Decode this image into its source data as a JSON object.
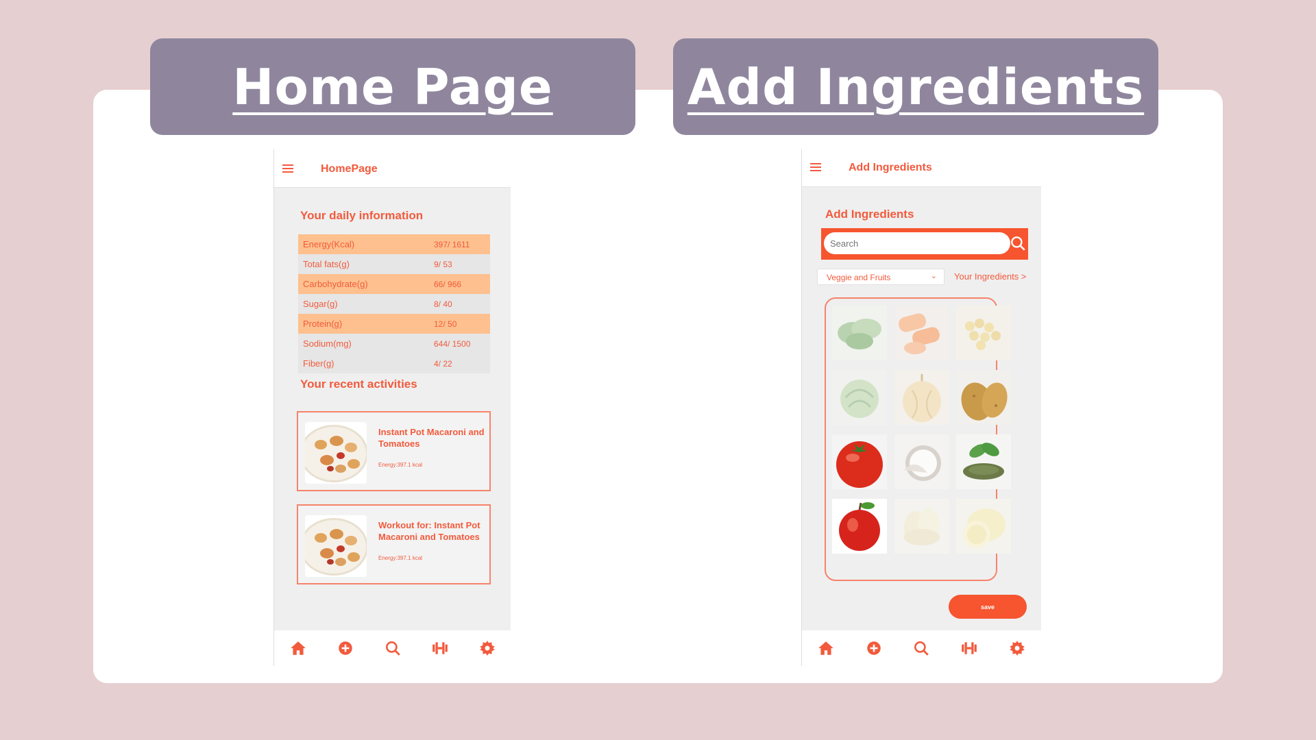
{
  "banners": {
    "home": "Home Page",
    "add": "Add Ingredients"
  },
  "home": {
    "appbar_title": "HomePage",
    "daily_title": "Your daily information",
    "nutrients": [
      {
        "name": "Energy(Kcal)",
        "value": "397/ 1611"
      },
      {
        "name": "Total fats(g)",
        "value": "9/ 53"
      },
      {
        "name": "Carbohydrate(g)",
        "value": "66/ 966"
      },
      {
        "name": "Sugar(g)",
        "value": "8/ 40"
      },
      {
        "name": "Protein(g)",
        "value": "12/ 50"
      },
      {
        "name": "Sodium(mg)",
        "value": "644/ 1500"
      },
      {
        "name": "Fiber(g)",
        "value": "4/ 22"
      }
    ],
    "recent_title": "Your recent activities",
    "activities": [
      {
        "title": "Instant Pot Macaroni and Tomatoes",
        "energy": "Energy:397.1 kcal"
      },
      {
        "title": "Workout for: Instant Pot Macaroni and Tomatoes",
        "energy": "Energy:397.1 kcal"
      }
    ]
  },
  "add": {
    "appbar_title": "Add Ingredients",
    "page_title": "Add Ingredients",
    "search_placeholder": "Search",
    "category": "Veggie and Fruits",
    "your_ingredients": "Your Ingredients >",
    "ingredients": [
      "spinach",
      "carrot",
      "chickpeas",
      "cabbage",
      "onion",
      "potato",
      "tomato",
      "coconut",
      "herbs",
      "apple",
      "garlic",
      "lemon"
    ],
    "save_label": "save"
  },
  "nav_icons": [
    "home-icon",
    "add-circle-icon",
    "search-icon",
    "dumbbell-icon",
    "gear-icon"
  ],
  "colors": {
    "accent": "#f25a3c",
    "highlight": "#fdc08e",
    "banner": "#8f869e",
    "background": "#e6cfd0"
  }
}
